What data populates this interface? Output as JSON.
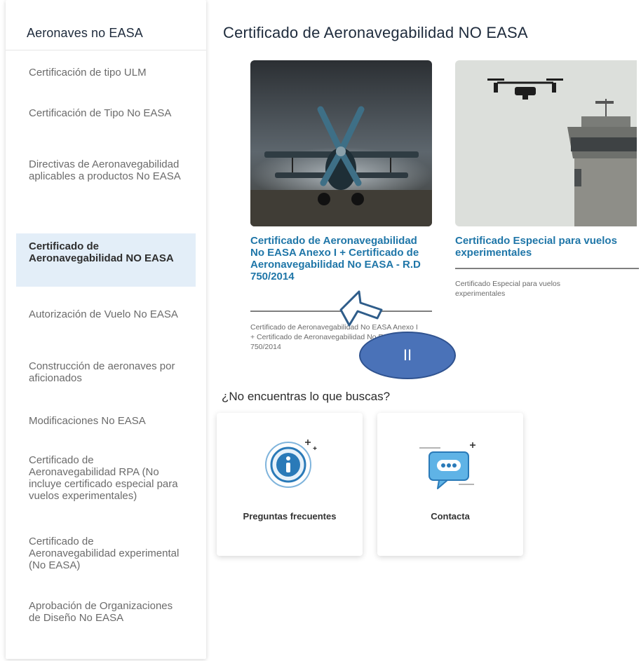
{
  "sidebar": {
    "title": "Aeronaves no EASA",
    "items": [
      {
        "label": "Certificación de tipo ULM",
        "active": false
      },
      {
        "label": "Certificación de Tipo No EASA",
        "active": false
      },
      {
        "label": "Directivas de Aeronavegabilidad aplicables a productos No EASA",
        "active": false
      },
      {
        "label": "Certificado de Aeronavegabilidad NO EASA",
        "active": true
      },
      {
        "label": "Autorización de Vuelo No EASA",
        "active": false
      },
      {
        "label": "Construcción de aeronaves por aficionados",
        "active": false
      },
      {
        "label": "Modificaciones No EASA",
        "active": false
      },
      {
        "label": "Certificado de Aeronavegabilidad RPA (No incluye certificado especial para vuelos experimentales)",
        "active": false
      },
      {
        "label": "Certificado de Aeronavegabilidad experimental (No EASA)",
        "active": false
      },
      {
        "label": "Aprobación de Organizaciones de Diseño No EASA",
        "active": false
      }
    ]
  },
  "main": {
    "title": "Certificado de Aeronavegabilidad NO EASA",
    "cards": [
      {
        "title": "Certificado de Aeronavegabilidad No EASA Anexo I + Certificado de Aeronavegabilidad No EASA - R.D 750/2014",
        "description": "Certificado de Aeronavegabilidad No EASA Anexo I + Certificado de Aeronavegabilidad No EASA - R.D 750/2014",
        "image_icon": "biplane-photo"
      },
      {
        "title": "Certificado Especial para vuelos experimentales",
        "description": "Certificado Especial para vuelos experimentales",
        "image_icon": "drone-tower-photo"
      }
    ],
    "help_heading": "¿No encuentras lo que buscas?",
    "help_tiles": [
      {
        "label": "Preguntas frecuentes",
        "icon": "info-icon"
      },
      {
        "label": "Contacta",
        "icon": "chat-icon"
      }
    ]
  },
  "overlay": {
    "badge_text": "II",
    "cursor_icon": "arrow-cursor-icon"
  },
  "colors": {
    "link": "#1f76a8",
    "active_bg": "#e3eef8",
    "overlay": "#4a72b8"
  }
}
